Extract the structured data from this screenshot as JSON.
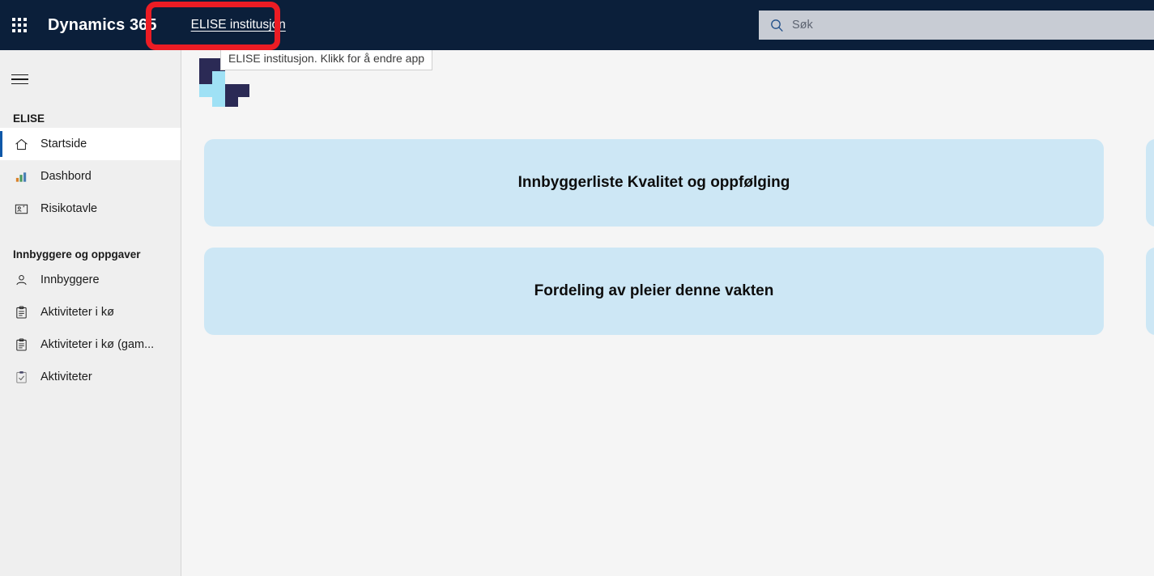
{
  "topbar": {
    "waffle_icon": "app-launcher-grid-icon",
    "brand": "Dynamics 365",
    "app_name": "ELISE institusjon",
    "search": {
      "icon": "search-icon",
      "placeholder": "Søk",
      "value": ""
    }
  },
  "annotation": {
    "color": "#ec1c24",
    "target": "app-name"
  },
  "tooltip": {
    "text": "ELISE institusjon. Klikk for å endre app"
  },
  "sidebar": {
    "hamburger_icon": "hamburger-menu-icon",
    "groups": [
      {
        "title": "ELISE",
        "items": [
          {
            "label": "Startside",
            "icon": "home-icon",
            "selected": true
          },
          {
            "label": "Dashbord",
            "icon": "bar-chart-icon",
            "selected": false
          },
          {
            "label": "Risikotavle",
            "icon": "id-card-icon",
            "selected": false
          }
        ]
      },
      {
        "title": "Innbyggere og oppgaver",
        "items": [
          {
            "label": "Innbyggere",
            "icon": "person-icon",
            "selected": false
          },
          {
            "label": "Aktiviteter i kø",
            "icon": "clipboard-lines-icon",
            "selected": false
          },
          {
            "label": "Aktiviteter i kø (gam...",
            "icon": "clipboard-lines-icon",
            "selected": false
          },
          {
            "label": "Aktiviteter",
            "icon": "clipboard-check-icon",
            "selected": false
          }
        ]
      }
    ]
  },
  "main": {
    "logo_icon": "elise-plus-logo",
    "logo_colors": {
      "dark": "#2b2a55",
      "light": "#9fe1f5"
    },
    "card_color": "#cde7f5",
    "cards": [
      {
        "title": "Innbyggerliste Kvalitet og oppfølging"
      },
      {
        "title": "Fordeling av pleier denne vakten"
      }
    ]
  }
}
